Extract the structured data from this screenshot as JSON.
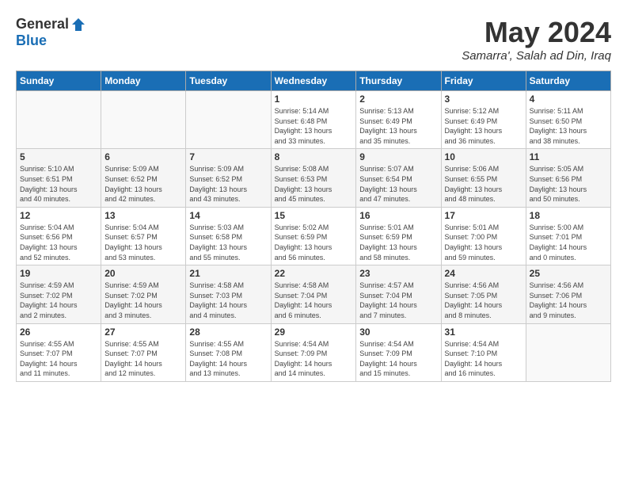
{
  "header": {
    "logo_general": "General",
    "logo_blue": "Blue",
    "title": "May 2024",
    "location": "Samarra', Salah ad Din, Iraq"
  },
  "days_of_week": [
    "Sunday",
    "Monday",
    "Tuesday",
    "Wednesday",
    "Thursday",
    "Friday",
    "Saturday"
  ],
  "weeks": [
    [
      {
        "day": "",
        "info": ""
      },
      {
        "day": "",
        "info": ""
      },
      {
        "day": "",
        "info": ""
      },
      {
        "day": "1",
        "info": "Sunrise: 5:14 AM\nSunset: 6:48 PM\nDaylight: 13 hours\nand 33 minutes."
      },
      {
        "day": "2",
        "info": "Sunrise: 5:13 AM\nSunset: 6:49 PM\nDaylight: 13 hours\nand 35 minutes."
      },
      {
        "day": "3",
        "info": "Sunrise: 5:12 AM\nSunset: 6:49 PM\nDaylight: 13 hours\nand 36 minutes."
      },
      {
        "day": "4",
        "info": "Sunrise: 5:11 AM\nSunset: 6:50 PM\nDaylight: 13 hours\nand 38 minutes."
      }
    ],
    [
      {
        "day": "5",
        "info": "Sunrise: 5:10 AM\nSunset: 6:51 PM\nDaylight: 13 hours\nand 40 minutes."
      },
      {
        "day": "6",
        "info": "Sunrise: 5:09 AM\nSunset: 6:52 PM\nDaylight: 13 hours\nand 42 minutes."
      },
      {
        "day": "7",
        "info": "Sunrise: 5:09 AM\nSunset: 6:52 PM\nDaylight: 13 hours\nand 43 minutes."
      },
      {
        "day": "8",
        "info": "Sunrise: 5:08 AM\nSunset: 6:53 PM\nDaylight: 13 hours\nand 45 minutes."
      },
      {
        "day": "9",
        "info": "Sunrise: 5:07 AM\nSunset: 6:54 PM\nDaylight: 13 hours\nand 47 minutes."
      },
      {
        "day": "10",
        "info": "Sunrise: 5:06 AM\nSunset: 6:55 PM\nDaylight: 13 hours\nand 48 minutes."
      },
      {
        "day": "11",
        "info": "Sunrise: 5:05 AM\nSunset: 6:56 PM\nDaylight: 13 hours\nand 50 minutes."
      }
    ],
    [
      {
        "day": "12",
        "info": "Sunrise: 5:04 AM\nSunset: 6:56 PM\nDaylight: 13 hours\nand 52 minutes."
      },
      {
        "day": "13",
        "info": "Sunrise: 5:04 AM\nSunset: 6:57 PM\nDaylight: 13 hours\nand 53 minutes."
      },
      {
        "day": "14",
        "info": "Sunrise: 5:03 AM\nSunset: 6:58 PM\nDaylight: 13 hours\nand 55 minutes."
      },
      {
        "day": "15",
        "info": "Sunrise: 5:02 AM\nSunset: 6:59 PM\nDaylight: 13 hours\nand 56 minutes."
      },
      {
        "day": "16",
        "info": "Sunrise: 5:01 AM\nSunset: 6:59 PM\nDaylight: 13 hours\nand 58 minutes."
      },
      {
        "day": "17",
        "info": "Sunrise: 5:01 AM\nSunset: 7:00 PM\nDaylight: 13 hours\nand 59 minutes."
      },
      {
        "day": "18",
        "info": "Sunrise: 5:00 AM\nSunset: 7:01 PM\nDaylight: 14 hours\nand 0 minutes."
      }
    ],
    [
      {
        "day": "19",
        "info": "Sunrise: 4:59 AM\nSunset: 7:02 PM\nDaylight: 14 hours\nand 2 minutes."
      },
      {
        "day": "20",
        "info": "Sunrise: 4:59 AM\nSunset: 7:02 PM\nDaylight: 14 hours\nand 3 minutes."
      },
      {
        "day": "21",
        "info": "Sunrise: 4:58 AM\nSunset: 7:03 PM\nDaylight: 14 hours\nand 4 minutes."
      },
      {
        "day": "22",
        "info": "Sunrise: 4:58 AM\nSunset: 7:04 PM\nDaylight: 14 hours\nand 6 minutes."
      },
      {
        "day": "23",
        "info": "Sunrise: 4:57 AM\nSunset: 7:04 PM\nDaylight: 14 hours\nand 7 minutes."
      },
      {
        "day": "24",
        "info": "Sunrise: 4:56 AM\nSunset: 7:05 PM\nDaylight: 14 hours\nand 8 minutes."
      },
      {
        "day": "25",
        "info": "Sunrise: 4:56 AM\nSunset: 7:06 PM\nDaylight: 14 hours\nand 9 minutes."
      }
    ],
    [
      {
        "day": "26",
        "info": "Sunrise: 4:55 AM\nSunset: 7:07 PM\nDaylight: 14 hours\nand 11 minutes."
      },
      {
        "day": "27",
        "info": "Sunrise: 4:55 AM\nSunset: 7:07 PM\nDaylight: 14 hours\nand 12 minutes."
      },
      {
        "day": "28",
        "info": "Sunrise: 4:55 AM\nSunset: 7:08 PM\nDaylight: 14 hours\nand 13 minutes."
      },
      {
        "day": "29",
        "info": "Sunrise: 4:54 AM\nSunset: 7:09 PM\nDaylight: 14 hours\nand 14 minutes."
      },
      {
        "day": "30",
        "info": "Sunrise: 4:54 AM\nSunset: 7:09 PM\nDaylight: 14 hours\nand 15 minutes."
      },
      {
        "day": "31",
        "info": "Sunrise: 4:54 AM\nSunset: 7:10 PM\nDaylight: 14 hours\nand 16 minutes."
      },
      {
        "day": "",
        "info": ""
      }
    ]
  ]
}
